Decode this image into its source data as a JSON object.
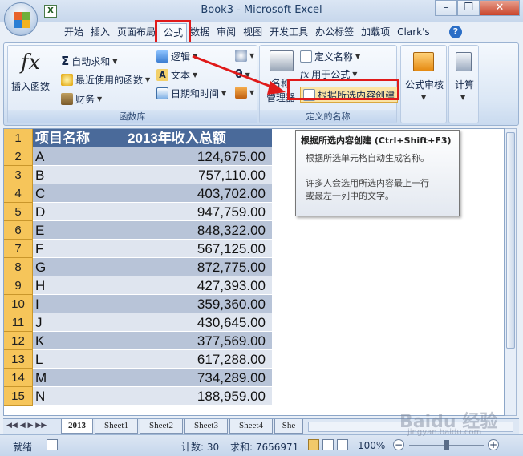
{
  "window": {
    "title": "Book3 - Microsoft Excel",
    "minimize": "–",
    "restore": "❐",
    "close": "✕"
  },
  "ribbon_tabs": [
    "开始",
    "插入",
    "页面布局",
    "公式",
    "数据",
    "审阅",
    "视图",
    "开发工具",
    "办公标签",
    "加载项",
    "Clark's"
  ],
  "active_tab": "公式",
  "ribbon": {
    "function_library": {
      "label": "函数库",
      "insert_function": "插入函数",
      "autosum": "自动求和",
      "recently_used": "最近使用的函数",
      "financial": "财务",
      "logical": "逻辑",
      "text": "文本",
      "date_time": "日期和时间"
    },
    "defined_names": {
      "label": "定义的名称",
      "name_manager_line1": "名称",
      "name_manager_line2": "管理器",
      "define_name": "定义名称",
      "use_in_formula": "用于公式",
      "create_from_selection": "根据所选内容创建"
    },
    "formula_auditing": "公式审核",
    "calculation": "计算"
  },
  "tooltip": {
    "title": "根据所选内容创建 (Ctrl+Shift+F3)",
    "line1": "根据所选单元格自动生成名称。",
    "line2": "许多人会选用所选内容最上一行",
    "line3": "或最左一列中的文字。"
  },
  "table": {
    "header": {
      "row": "1",
      "col_a": "项目名称",
      "col_b": "2013年收入总额"
    },
    "rows": [
      {
        "row": "2",
        "name": "A",
        "value": "124,675.00"
      },
      {
        "row": "3",
        "name": "B",
        "value": "757,110.00"
      },
      {
        "row": "4",
        "name": "C",
        "value": "403,702.00"
      },
      {
        "row": "5",
        "name": "D",
        "value": "947,759.00"
      },
      {
        "row": "6",
        "name": "E",
        "value": "848,322.00"
      },
      {
        "row": "7",
        "name": "F",
        "value": "567,125.00"
      },
      {
        "row": "8",
        "name": "G",
        "value": "872,775.00"
      },
      {
        "row": "9",
        "name": "H",
        "value": "427,393.00"
      },
      {
        "row": "10",
        "name": "I",
        "value": "359,360.00"
      },
      {
        "row": "11",
        "name": "J",
        "value": "430,645.00"
      },
      {
        "row": "12",
        "name": "K",
        "value": "377,569.00"
      },
      {
        "row": "13",
        "name": "L",
        "value": "617,288.00"
      },
      {
        "row": "14",
        "name": "M",
        "value": "734,289.00"
      },
      {
        "row": "15",
        "name": "N",
        "value": "188,959.00"
      }
    ]
  },
  "sheet_tabs": [
    "2013",
    "Sheet1",
    "Sheet2",
    "Sheet3",
    "Sheet4",
    "She"
  ],
  "active_sheet": "2013",
  "status": {
    "ready": "就绪",
    "count": "计数: 30",
    "sum": "求和: 7656971",
    "zoom": "100%"
  },
  "watermark": {
    "line1": "Baidu 经验",
    "line2": "jingyan.baidu.com"
  },
  "colors": {
    "highlight": "#e01a1a",
    "header_bg": "#4a6a9a",
    "row_number_bg": "#f6c55a"
  }
}
